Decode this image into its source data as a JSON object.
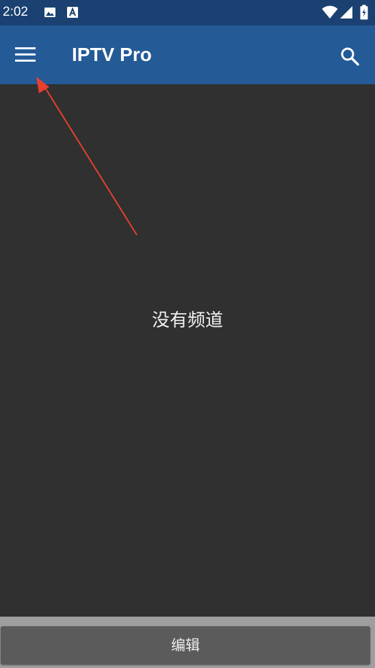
{
  "status_bar": {
    "time": "2:02",
    "left_icons": [
      "image-icon",
      "font-a-icon"
    ],
    "right_icons": [
      "wifi-icon",
      "signal-icon",
      "battery-icon"
    ]
  },
  "app_bar": {
    "title": "IPTV Pro",
    "menu_icon": "hamburger-menu-icon",
    "search_icon": "search-icon"
  },
  "content": {
    "empty_message": "没有频道"
  },
  "bottom_bar": {
    "edit_label": "编辑"
  },
  "colors": {
    "status_bar": "#1a4171",
    "app_bar": "#245a96",
    "background": "#303030",
    "annotation_arrow": "#e8402f",
    "bottom_bar": "#9e9e9e",
    "edit_button": "#5b5b5b"
  }
}
